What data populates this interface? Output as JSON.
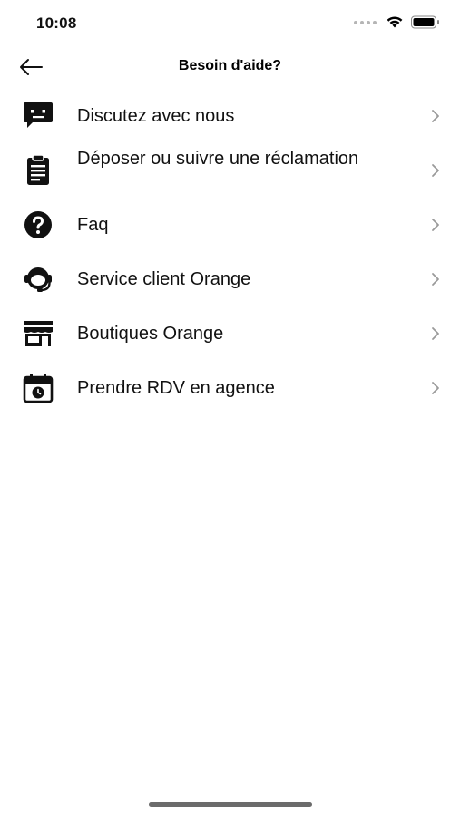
{
  "status_bar": {
    "time": "10:08",
    "icons": [
      "signal-dots-icon",
      "wifi-icon",
      "battery-icon"
    ]
  },
  "header": {
    "title": "Besoin d'aide?",
    "back_icon": "arrow-left-icon"
  },
  "menu": {
    "items": [
      {
        "label": "Discutez avec nous",
        "icon": "chat-bubble-icon"
      },
      {
        "label": "Déposer ou suivre une réclamation",
        "icon": "clipboard-icon"
      },
      {
        "label": "Faq",
        "icon": "question-circle-icon"
      },
      {
        "label": "Service client Orange",
        "icon": "headset-agent-icon"
      },
      {
        "label": "Boutiques Orange",
        "icon": "store-icon"
      },
      {
        "label": "Prendre RDV en agence",
        "icon": "calendar-clock-icon"
      }
    ],
    "chevron_icon": "chevron-right-icon"
  },
  "colors": {
    "text": "#111111",
    "chevron": "#9a9a9a",
    "background": "#ffffff"
  }
}
